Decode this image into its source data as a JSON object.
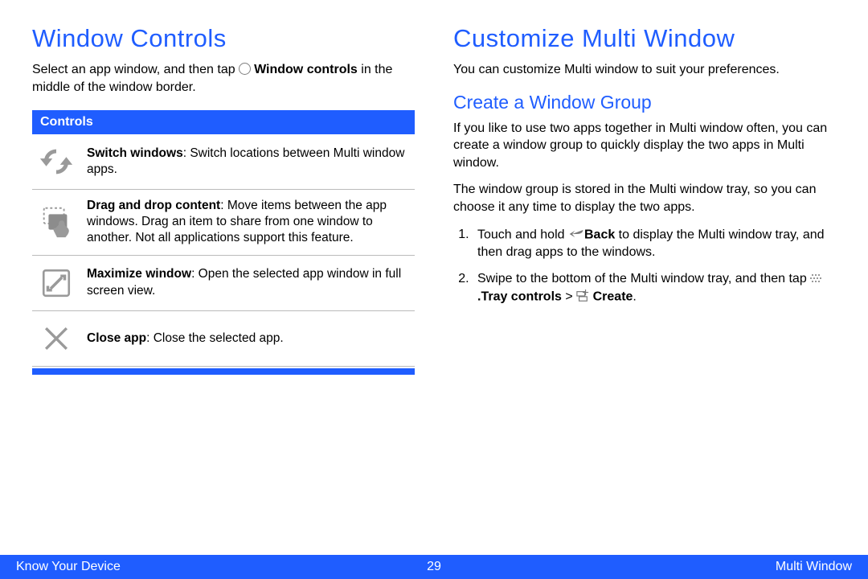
{
  "left": {
    "heading": "Window Controls",
    "intro_parts": {
      "p1": "Select an app window, and then tap ",
      "bold": "Window controls",
      "p2": " in the middle of the window border."
    },
    "table_header": "Controls",
    "rows": [
      {
        "icon": "switch",
        "bold": "Switch windows",
        "rest": ": Switch locations between Multi window apps."
      },
      {
        "icon": "drag",
        "bold": "Drag and drop content",
        "rest": ": Move items between the app windows. Drag an item to share from one window to another. Not all applications support this feature."
      },
      {
        "icon": "maximize",
        "bold": "Maximize window",
        "rest": ": Open the selected app window in full screen view."
      },
      {
        "icon": "close",
        "bold": "Close app",
        "rest": ": Close the selected app."
      }
    ]
  },
  "right": {
    "heading": "Customize Multi Window",
    "intro": "You can customize Multi window to suit your preferences.",
    "sub_heading": "Create a Window Group",
    "para1": "If you like to use two apps together in Multi window often, you can create a window group to quickly display the two apps in Multi window.",
    "para2": "The window group is stored in the Multi window tray, so you can choose it any time to display the two apps.",
    "steps": {
      "s1": {
        "a": "Touch and hold ",
        "back_bold": "Back",
        "b": " to display the Multi window tray, and then drag apps to the windows."
      },
      "s2": {
        "a": "Swipe to the bottom of the Multi window tray, and then tap ",
        "tray": ".Tray controls",
        "gt": " > ",
        "create": "Create",
        "end": "."
      }
    }
  },
  "footer": {
    "left": "Know Your Device",
    "page": "29",
    "right": "Multi Window"
  }
}
